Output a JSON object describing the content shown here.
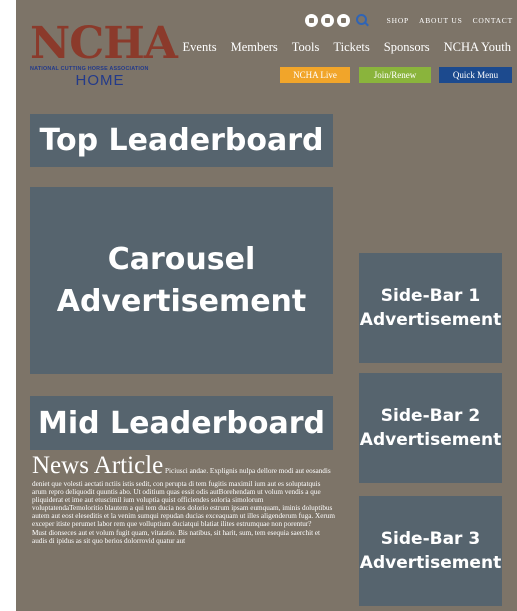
{
  "logo": {
    "wordmark": "NCHA",
    "tagline": "NATIONAL CUTTING HORSE ASSOCIATION",
    "home": "HOME"
  },
  "utility": {
    "social_icons": [
      "facebook-icon",
      "instagram-icon",
      "twitter-icon"
    ],
    "links": [
      "SHOP",
      "ABOUT US",
      "CONTACT"
    ]
  },
  "nav": {
    "items": [
      "Events",
      "Members",
      "Tools",
      "Tickets",
      "Sponsors",
      "NCHA Youth"
    ]
  },
  "buttons": {
    "live": "NCHA Live",
    "join": "Join/Renew",
    "menu": "Quick Menu"
  },
  "ads": {
    "top": "Top Leaderboard",
    "carousel_line1": "Carousel",
    "carousel_line2": "Advertisement",
    "mid": "Mid Leaderboard",
    "side1_line1": "Side-Bar 1",
    "side1_line2": "Advertisement",
    "side2_line1": "Side-Bar 2",
    "side2_line2": "Advertisement",
    "side3_line1": "Side-Bar 3",
    "side3_line2": "Advertisement"
  },
  "news": {
    "title": "News Article",
    "lead": "Piciusci andae. Explignis nulpa dellore modi aut eosandis deniet que volesti aectati nctiis istis sedit, con perupta di tem fugitis maximil ium aut es soluptatquis arum repro deliquodit quuntis abo. Ut oditium quas essit odis autBorehendam ut volum vendis a que pliquiderat et ime aut etuscimil ium voluptia quist officiendes soloria simolorum voluptatendaTemoloritio blautem a qui tem ducia nos dolorio estrum ipsam eumquam, iminis doluptibus autem aut eost eleseditis et la venim sumqui repudan ducias exceaquam ut illes aligenderum fuga. Xerum exceper itiste perumet labor rem que volluptium duciatqui blatiat ilites estrumquae non porentur?",
    "para2": "Must dionseces aut et volum fugit quam, vitatatio. Bis natibus, sit harit, sum, tem esequia saerchit et audis di ipidus as sit quo berios dolorrovid quatur aut"
  },
  "colors": {
    "background": "#7d7468",
    "ad_block": "#56646e",
    "live_button": "#f1a52a",
    "join_button": "#8ab43c",
    "menu_button": "#1c4a8e",
    "logo_red": "#8b3a2b",
    "logo_blue": "#233a8a"
  }
}
